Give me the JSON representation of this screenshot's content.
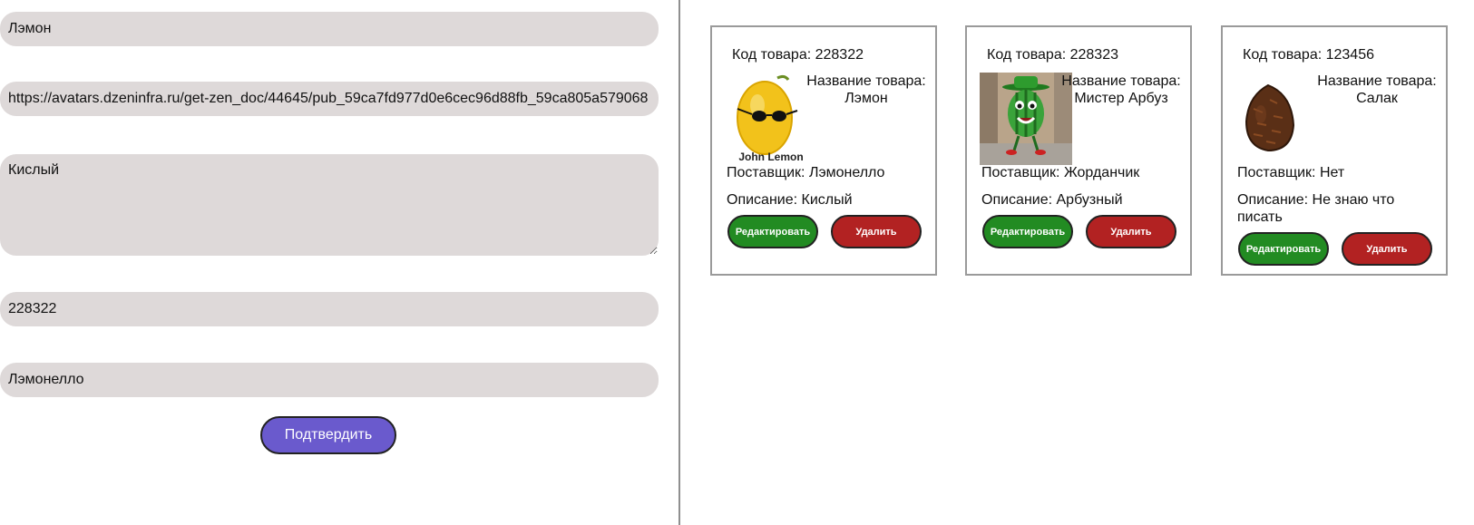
{
  "form": {
    "name_value": "Лэмон",
    "image_url_value": "https://avatars.dzeninfra.ru/get-zen_doc/44645/pub_59ca7fd977d0e6cec96d88fb_59ca805a579068",
    "description_value": "Кислый",
    "code_value": "228322",
    "supplier_value": "Лэмонелло",
    "submit_label": "Подтвердить",
    "colors": {
      "field_bg": "#ded9d9",
      "submit_bg": "#6a5acd"
    }
  },
  "cards": [
    {
      "code": "Код товара: 228322",
      "name": "Название товара: Лэмон",
      "image_caption": "John Lemon",
      "image_icon": "lemon-with-sunglasses",
      "supplier": "Поставщик: Лэмонелло",
      "description": "Описание: Кислый",
      "edit_label": "Редактировать",
      "delete_label": "Удалить"
    },
    {
      "code": "Код товара: 228323",
      "name": "Название товара: Мистер Арбуз",
      "image_icon": "watermelon-character",
      "supplier": "Поставщик: Жорданчик",
      "description": "Описание: Арбузный",
      "edit_label": "Редактировать",
      "delete_label": "Удалить"
    },
    {
      "code": "Код товара: 123456",
      "name": "Название товара: Салак",
      "image_icon": "salak-fruit",
      "supplier": "Поставщик: Нет",
      "description": "Описание: Не знаю что писать",
      "edit_label": "Редактировать",
      "delete_label": "Удалить"
    }
  ],
  "colors": {
    "edit": "#228b22",
    "delete": "#b22222",
    "divider": "#8f8f8f",
    "card_border": "#9a9a9a"
  }
}
